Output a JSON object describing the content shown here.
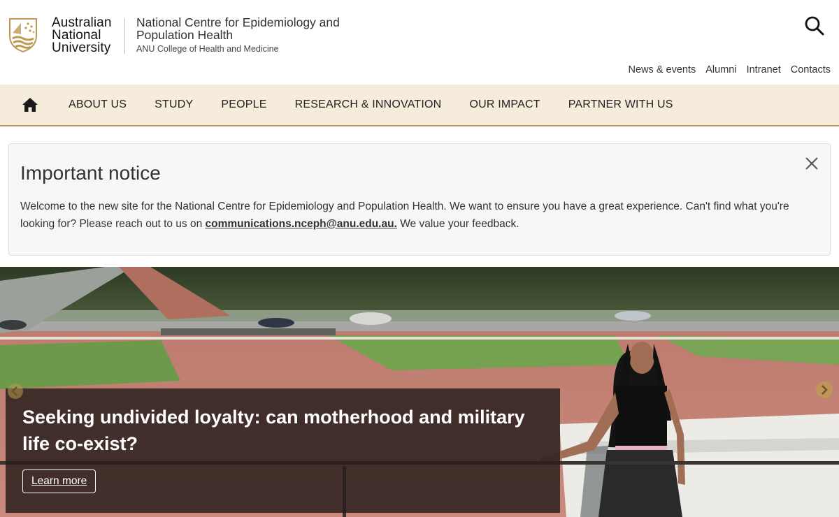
{
  "header": {
    "university_lines": [
      "Australian",
      "National",
      "University"
    ],
    "centre_name": "National Centre for Epidemiology and Population Health",
    "college_name": "ANU College of Health and Medicine",
    "search_icon": "search-icon",
    "utility_links": [
      "News & events",
      "Alumni",
      "Intranet",
      "Contacts"
    ]
  },
  "nav": {
    "home_icon": "home-icon",
    "items": [
      "ABOUT US",
      "STUDY",
      "PEOPLE",
      "RESEARCH & INNOVATION",
      "OUR IMPACT",
      "PARTNER WITH US"
    ]
  },
  "notice": {
    "title": "Important notice",
    "body_before": "Welcome to the new site for the National Centre for Epidemiology and Population Health. We want to ensure you have a great experience. Can't find what you're looking for? Please reach out to us on ",
    "email_link": "communications.nceph@anu.edu.au.",
    "body_after": " We value your feedback.",
    "close_icon": "close-icon"
  },
  "hero": {
    "caption_title": "Seeking undivided loyalty: can motherhood and military life co-exist?",
    "button_label": "Learn more",
    "prev_icon": "chevron-left-icon",
    "next_icon": "chevron-right-icon"
  },
  "colors": {
    "nav_background": "#f5ecdc",
    "nav_border": "#be9a53",
    "crest_gold": "#be9a53",
    "caption_background": "#281e1c"
  }
}
